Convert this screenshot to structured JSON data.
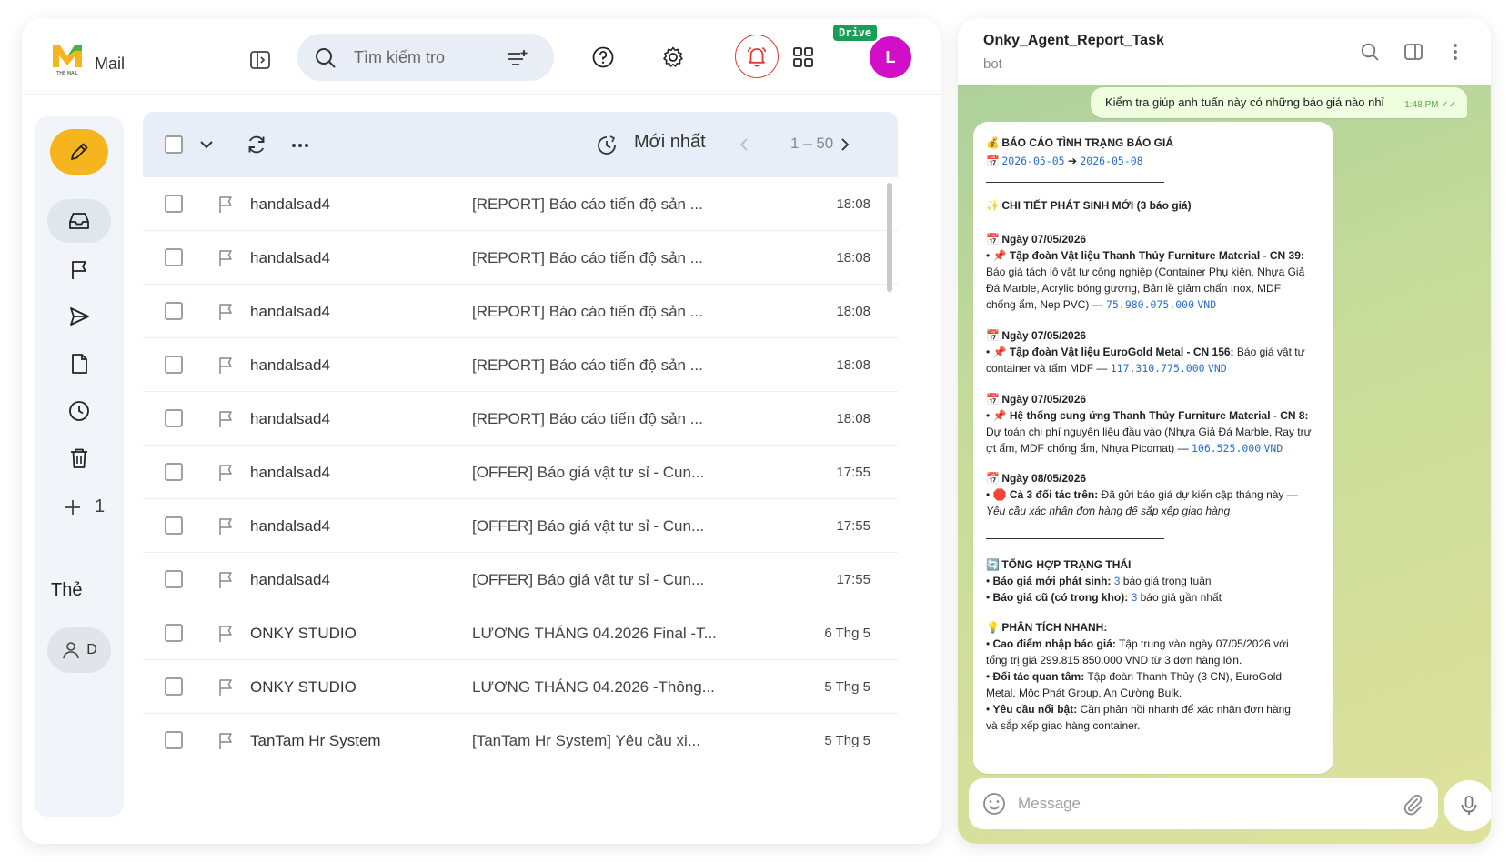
{
  "mail": {
    "brand": "Mail",
    "logo_text": "THE MAIL",
    "search_placeholder": "Tìm kiếm tro",
    "drive_badge": "Drive",
    "avatar_letter": "L",
    "rail": {
      "plus_count": "1",
      "label": "Thẻ",
      "user_initial": "D"
    },
    "toolbar": {
      "sort_label": "Mới nhất",
      "range": "1 – 50"
    },
    "emails": [
      {
        "sender": "handalsad4",
        "subject": "[REPORT] Báo cáo tiến độ sản ...",
        "time": "18:08"
      },
      {
        "sender": "handalsad4",
        "subject": "[REPORT] Báo cáo tiến độ sản ...",
        "time": "18:08"
      },
      {
        "sender": "handalsad4",
        "subject": "[REPORT] Báo cáo tiến độ sản ...",
        "time": "18:08"
      },
      {
        "sender": "handalsad4",
        "subject": "[REPORT] Báo cáo tiến độ sản ...",
        "time": "18:08"
      },
      {
        "sender": "handalsad4",
        "subject": "[REPORT] Báo cáo tiến độ sản ...",
        "time": "18:08"
      },
      {
        "sender": "handalsad4",
        "subject": "[OFFER] Báo giá vật tư sỉ - Cun...",
        "time": "17:55"
      },
      {
        "sender": "handalsad4",
        "subject": "[OFFER] Báo giá vật tư sỉ - Cun...",
        "time": "17:55"
      },
      {
        "sender": "handalsad4",
        "subject": "[OFFER] Báo giá vật tư sỉ - Cun...",
        "time": "17:55"
      },
      {
        "sender": "ONKY STUDIO",
        "subject": "LƯƠNG THÁNG 04.2026 Final -T...",
        "time": "6 Thg 5"
      },
      {
        "sender": "ONKY STUDIO",
        "subject": "LƯƠNG THÁNG 04.2026 -Thông...",
        "time": "5 Thg 5"
      },
      {
        "sender": "TanTam Hr System",
        "subject": "[TanTam Hr System] Yêu cầu xi...",
        "time": "5 Thg 5"
      }
    ]
  },
  "telegram": {
    "title": "Onky_Agent_Report_Task",
    "subtitle": "bot",
    "outgoing": {
      "text": "Kiểm tra giúp anh tuấn này có những báo giá nào nhỉ",
      "time": "1:48 PM"
    },
    "report": {
      "heading": "BÁO CÁO TÌNH TRẠNG BÁO GIÁ",
      "date_from": "2026-05-05",
      "arrow": "➔",
      "date_to": "2026-05-08",
      "section1": "CHI TIẾT PHÁT SINH MỚI (3 báo giá)",
      "entries": [
        {
          "date": "Ngày 07/05/2026",
          "name": "Tập đoàn Vật liệu Thanh Thủy Furniture Material - CN 39:",
          "line2": "Báo giá tách lô vật tư công nghiệp (Container Phụ kiện, Nhựa Giả",
          "line3": "Đá Marble, Acrylic bóng gương, Bản lề giảm chấn Inox, MDF",
          "line4_prefix": "chống ẩm, Nẹp PVC) —",
          "amount": "75.980.075.000",
          "currency": "VND"
        },
        {
          "date": "Ngày 07/05/2026",
          "name": "Tập đoàn Vật liệu EuroGold Metal - CN 156:",
          "name_tail": "Báo giá vật tư",
          "line2_prefix": "container và tấm MDF —",
          "amount": "117.310.775.000",
          "currency": "VND"
        },
        {
          "date": "Ngày 07/05/2026",
          "name": "Hệ thống cung ứng Thanh Thủy Furniture Material - CN 8:",
          "line2": "Dự toán chi phí nguyên liệu đầu vào (Nhựa Giả Đá Marble, Ray trư",
          "line3_prefix": "ợt ẩm, MDF chống ẩm, Nhựa Picomat) —",
          "amount": "106.525.000",
          "currency": "VND"
        }
      ],
      "entry4": {
        "date": "Ngày 08/05/2026",
        "bold": "Cả 3 đối tác trên:",
        "text": "Đã gửi báo giá dự kiến cập tháng này —",
        "italic": "Yêu cầu xác nhận đơn hàng để sắp xếp giao hàng"
      },
      "section2": "TỔNG HỢP TRẠNG THÁI",
      "summary": [
        {
          "label": "Báo giá mới phát sinh:",
          "count": "3",
          "rest": "báo giá trong tuần"
        },
        {
          "label": "Báo giá cũ (có trong kho):",
          "count": "3",
          "rest": "báo giá gần nhất"
        }
      ],
      "section3": "PHÂN TÍCH NHANH:",
      "analysis": [
        {
          "label": "Cao điểm nhập báo giá:",
          "text": "Tập trung vào ngày 07/05/2026 với",
          "text2": "tổng trị giá 299.815.850.000 VND từ 3 đơn hàng lớn."
        },
        {
          "label": "Đối tác quan tâm:",
          "text": "Tập đoàn Thanh Thủy (3 CN), EuroGold",
          "text2": "Metal, Mộc Phát Group, An Cường Bulk."
        },
        {
          "label": "Yêu cầu nổi bật:",
          "text": "Cần phản hồi nhanh để xác nhận đơn hàng",
          "text2": "và sắp xếp giao hàng container."
        }
      ]
    },
    "composer_placeholder": "Message"
  }
}
